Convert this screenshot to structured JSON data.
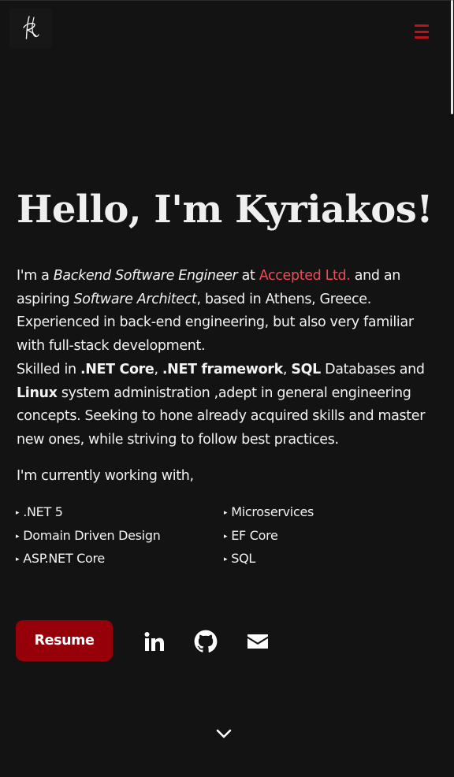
{
  "logo": {
    "icon": "signature-logo-icon"
  },
  "nav": {
    "menu_icon": "hamburger-menu-icon",
    "accent_color": "#c0111b"
  },
  "hero": {
    "heading": "Hello, I'm Kyriakos!",
    "intro": {
      "t1": "I'm a ",
      "role": "Backend Software Engineer",
      "t2": " at ",
      "company": "Accepted Ltd.",
      "t3": " and an aspiring ",
      "aspiration": "Software Architect",
      "t4": ", based in Athens, Greece. Experienced in back-end engineering, but also very familiar with full-stack development.",
      "t5": "Skilled in ",
      "skill1": ".NET Core",
      "sep1": ", ",
      "skill2": ".NET framework",
      "sep2": ", ",
      "skill3": "SQL",
      "t6": " Databases and ",
      "skill4": "Linux",
      "t7": " system administration ,adept in general engineering concepts. Seeking to hone already acquired skills and master new ones, while striving to follow best practices."
    },
    "working_with": "I'm currently working with,",
    "technologies": [
      ".NET 5",
      "Microservices",
      "Domain Driven Design",
      "EF Core",
      "ASP.NET Core",
      "SQL"
    ]
  },
  "actions": {
    "resume_label": "Resume",
    "resume_color": "#960008",
    "socials": [
      "linkedin-icon",
      "github-icon",
      "mail-icon"
    ]
  },
  "scroll": {
    "icon": "chevron-down-icon"
  },
  "colors": {
    "background": "#131313",
    "text": "#f0f0f0",
    "link": "#f04a55"
  }
}
